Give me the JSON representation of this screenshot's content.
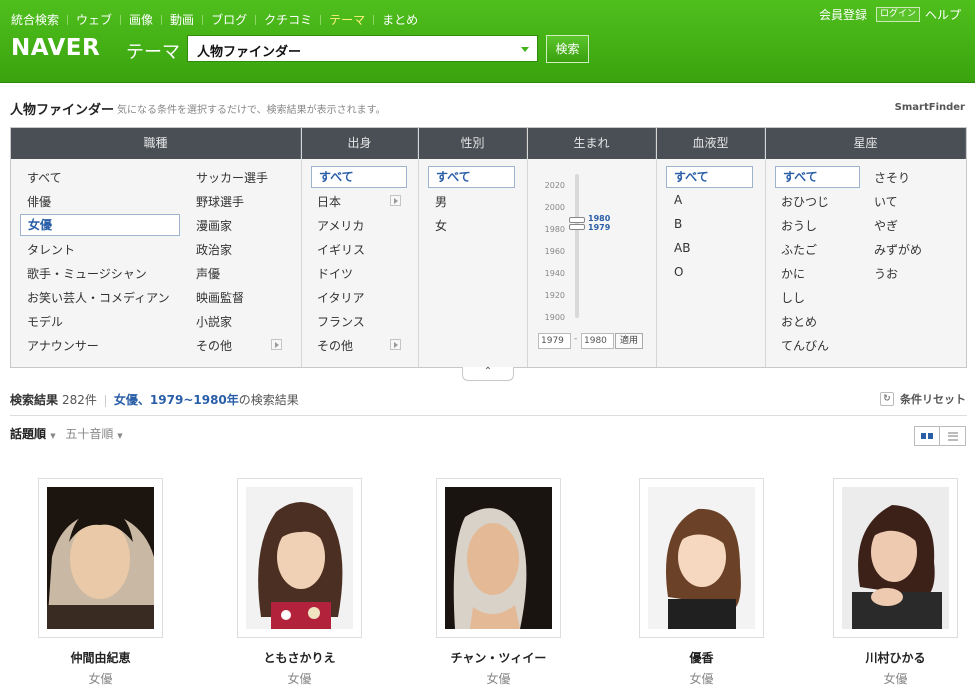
{
  "topnav": [
    "統合検索",
    "ウェブ",
    "画像",
    "動画",
    "ブログ",
    "クチコミ",
    "テーマ",
    "まとめ"
  ],
  "topnav_active_index": 6,
  "toplinks": {
    "register": "会員登録",
    "login": "ログイン",
    "help": "ヘルプ"
  },
  "logo": "NAVER",
  "logo_sub": "テーマ",
  "search": {
    "value": "人物ファインダー",
    "button": "検索"
  },
  "finder": {
    "title": "人物ファインダー",
    "description": "気になる条件を選択するだけで、検索結果が表示されます。",
    "brand": "SmartFinder"
  },
  "columns": {
    "occupation": {
      "head": "職種",
      "col1": [
        "すべて",
        "俳優",
        "女優",
        "タレント",
        "歌手・ミュージシャン",
        "お笑い芸人・コメディアン",
        "モデル",
        "アナウンサー"
      ],
      "col2": [
        "サッカー選手",
        "野球選手",
        "漫画家",
        "政治家",
        "声優",
        "映画監督",
        "小説家",
        "その他"
      ]
    },
    "origin": {
      "head": "出身",
      "items": [
        "すべて",
        "日本",
        "アメリカ",
        "イギリス",
        "ドイツ",
        "イタリア",
        "フランス",
        "その他"
      ]
    },
    "gender": {
      "head": "性別",
      "items": [
        "すべて",
        "男",
        "女"
      ]
    },
    "birth": {
      "head": "生まれ",
      "ticks": [
        "2020",
        "2000",
        "1980",
        "1960",
        "1940",
        "1920",
        "1900"
      ],
      "handle_upper": "1980",
      "handle_lower": "1979",
      "from": "1979",
      "dash": "-",
      "to": "1980",
      "apply": "適用"
    },
    "blood": {
      "head": "血液型",
      "items": [
        "すべて",
        "A",
        "B",
        "AB",
        "O"
      ]
    },
    "zodiac": {
      "head": "星座",
      "col1": [
        "すべて",
        "おひつじ",
        "おうし",
        "ふたご",
        "かに",
        "しし",
        "おとめ",
        "てんびん"
      ],
      "col2": [
        "さそり",
        "いて",
        "やぎ",
        "みずがめ",
        "うお"
      ]
    }
  },
  "results": {
    "label": "検索結果",
    "count": "282件",
    "condition": "女優、1979~1980年",
    "suffix": "の検索結果",
    "reset": "条件リセット"
  },
  "sort": {
    "active": "話題順",
    "other": "五十音順"
  },
  "people": [
    {
      "name": "仲間由紀恵",
      "occupation": "女優"
    },
    {
      "name": "ともさかりえ",
      "occupation": "女優"
    },
    {
      "name": "チャン・ツィイー",
      "occupation": "女優"
    },
    {
      "name": "優香",
      "occupation": "女優"
    },
    {
      "name": "川村ひかる",
      "occupation": "女優"
    }
  ],
  "colors": {
    "header_green": "#3aa30e",
    "active_nav": "#fff27a",
    "selected_blue": "#2a5fa8",
    "table_head": "#4a4f55"
  }
}
